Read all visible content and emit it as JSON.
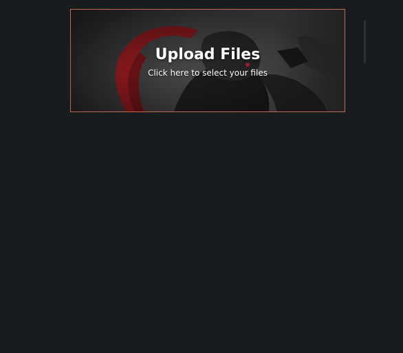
{
  "upload": {
    "title": "Upload Files",
    "subtitle": "Click here to select your files"
  },
  "colors": {
    "page_background": "#181c1f",
    "upload_border": "#c8674a",
    "text": "#ffffff"
  }
}
